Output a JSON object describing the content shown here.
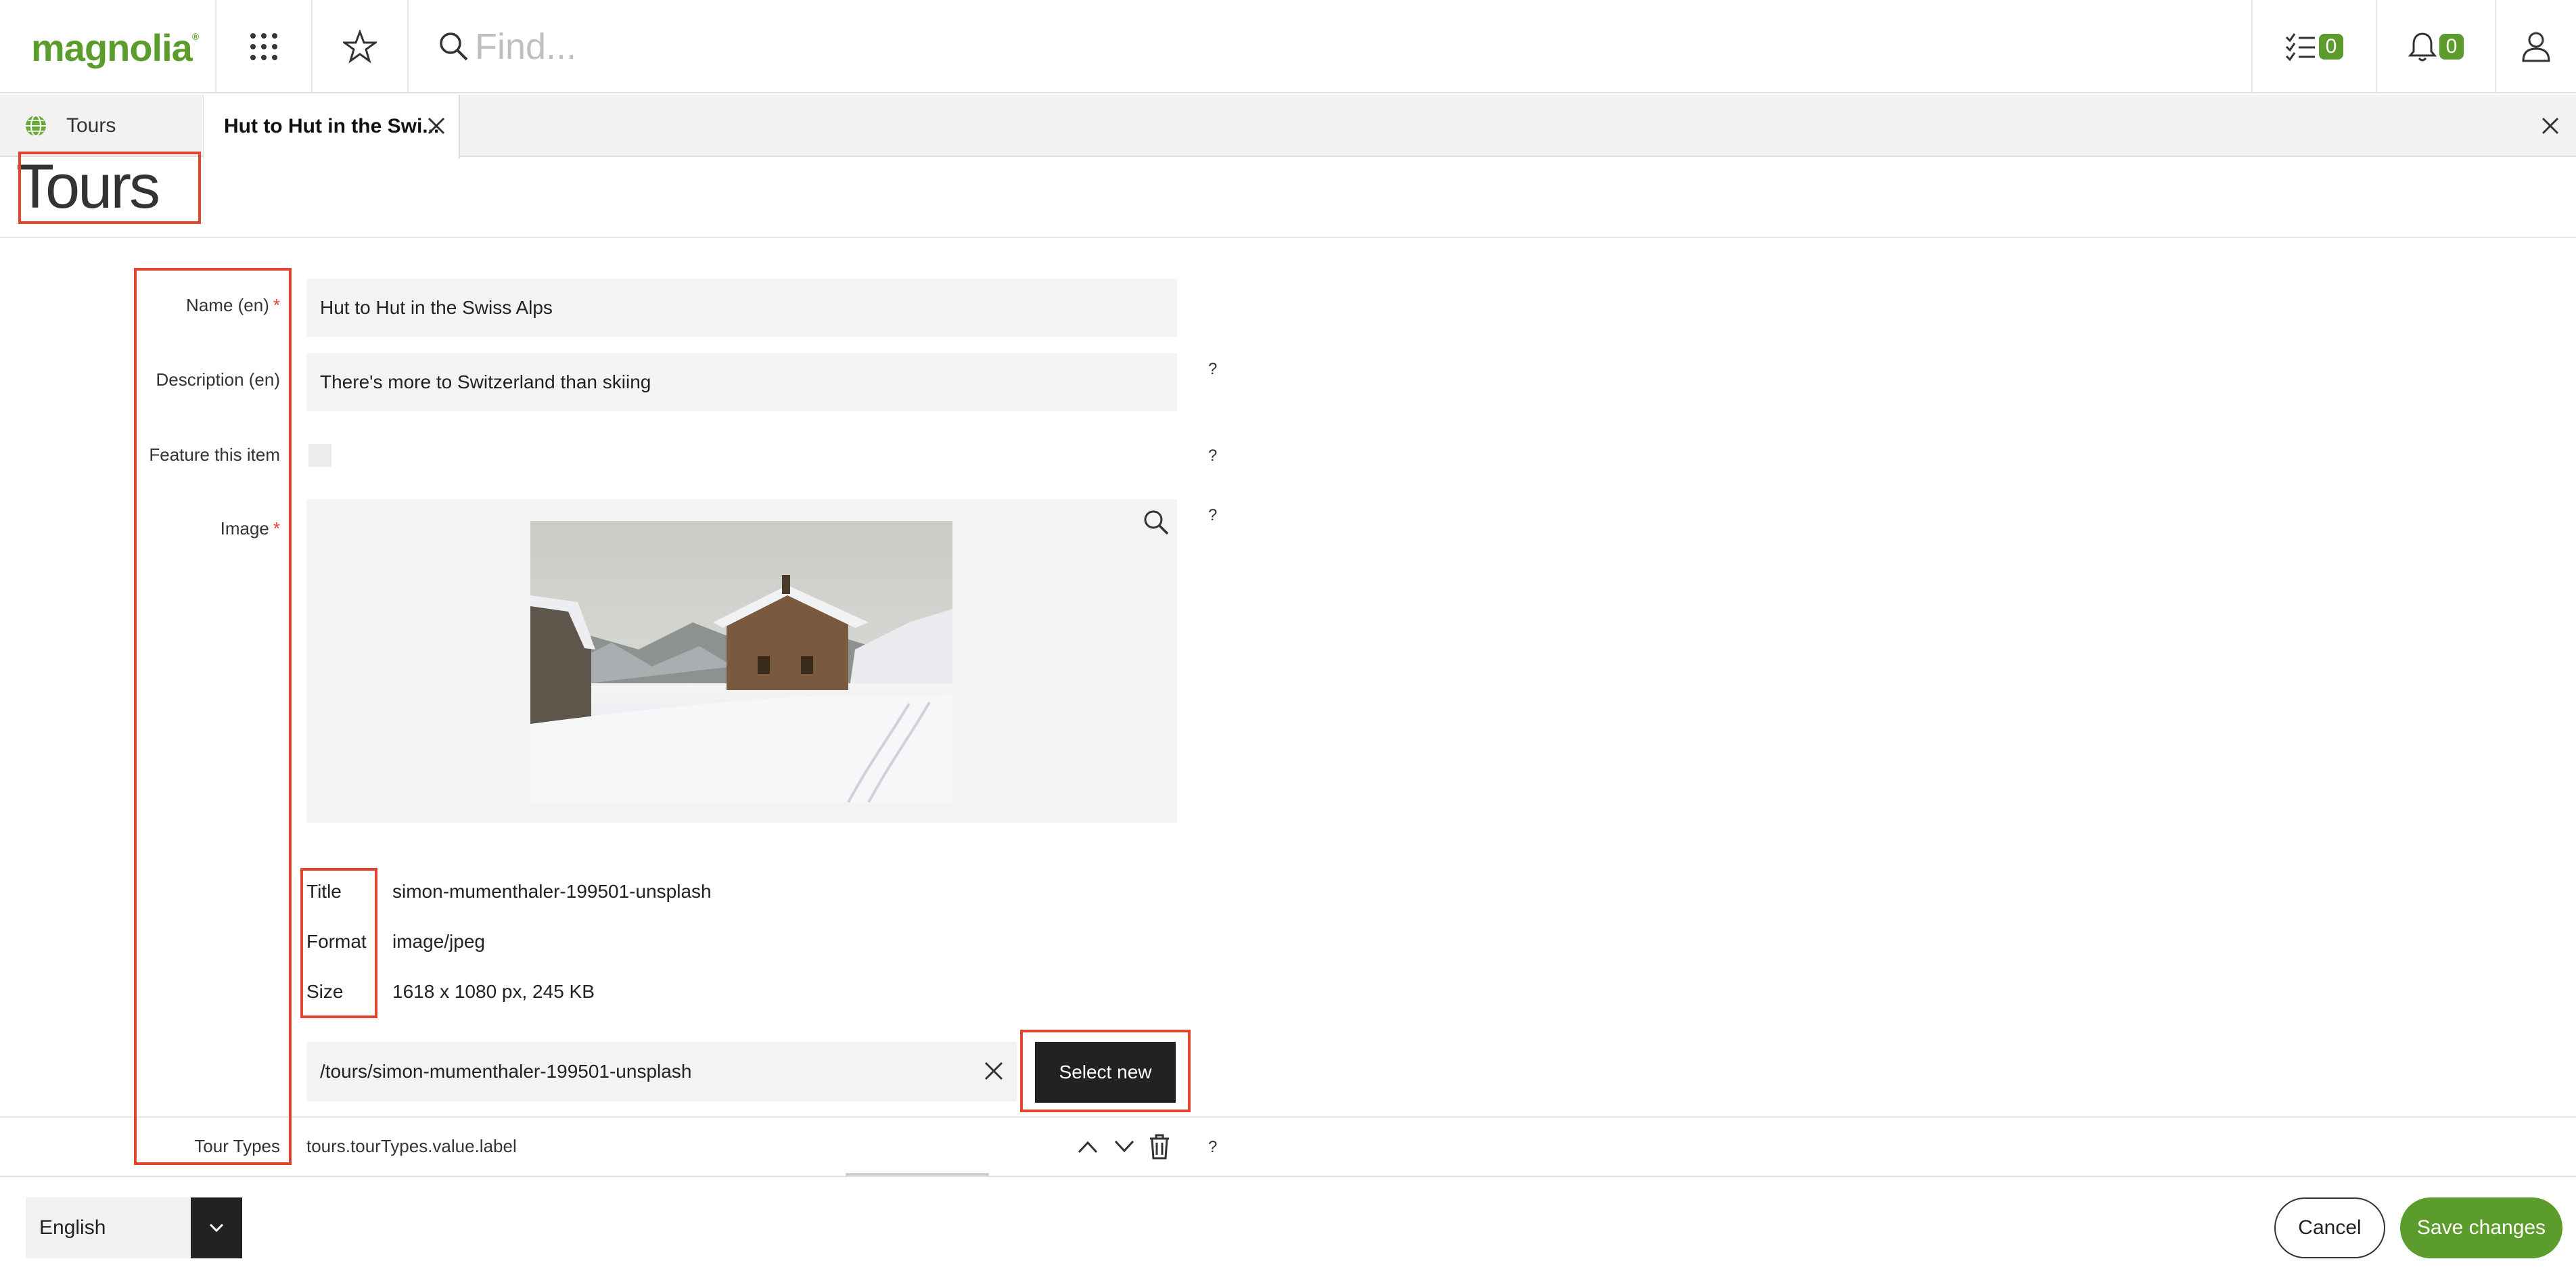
{
  "app": {
    "logo": "magnolia"
  },
  "topbar": {
    "search_placeholder": "Find...",
    "tasks_count": "0",
    "notifications_count": "0"
  },
  "tabs": [
    {
      "label": "Tours"
    },
    {
      "label": "Hut to Hut in the Swi..."
    }
  ],
  "page": {
    "title": "Tours"
  },
  "form": {
    "name": {
      "label": "Name (en)",
      "required": "*",
      "value": "Hut to Hut in the Swiss Alps"
    },
    "description": {
      "label": "Description (en)",
      "value": "There's more to Switzerland than skiing",
      "help": "?"
    },
    "featured": {
      "label": "Feature this item",
      "help": "?"
    },
    "image": {
      "label": "Image",
      "required": "*",
      "help": "?",
      "meta": [
        {
          "label": "Title",
          "value": "simon-mumenthaler-199501-unsplash"
        },
        {
          "label": "Format",
          "value": "image/jpeg"
        },
        {
          "label": "Size",
          "value": "1618 x 1080 px, 245 KB"
        }
      ],
      "path": "/tours/simon-mumenthaler-199501-unsplash",
      "select_new_label": "Select new"
    },
    "tour_types": {
      "label": "Tour Types",
      "value": "tours.tourTypes.value.label",
      "help": "?"
    }
  },
  "footer": {
    "language": "English",
    "cancel_label": "Cancel",
    "save_label": "Save changes"
  },
  "colors": {
    "brand": "#5b9c2c",
    "annotation": "#e2452d",
    "dark_button": "#222222"
  }
}
